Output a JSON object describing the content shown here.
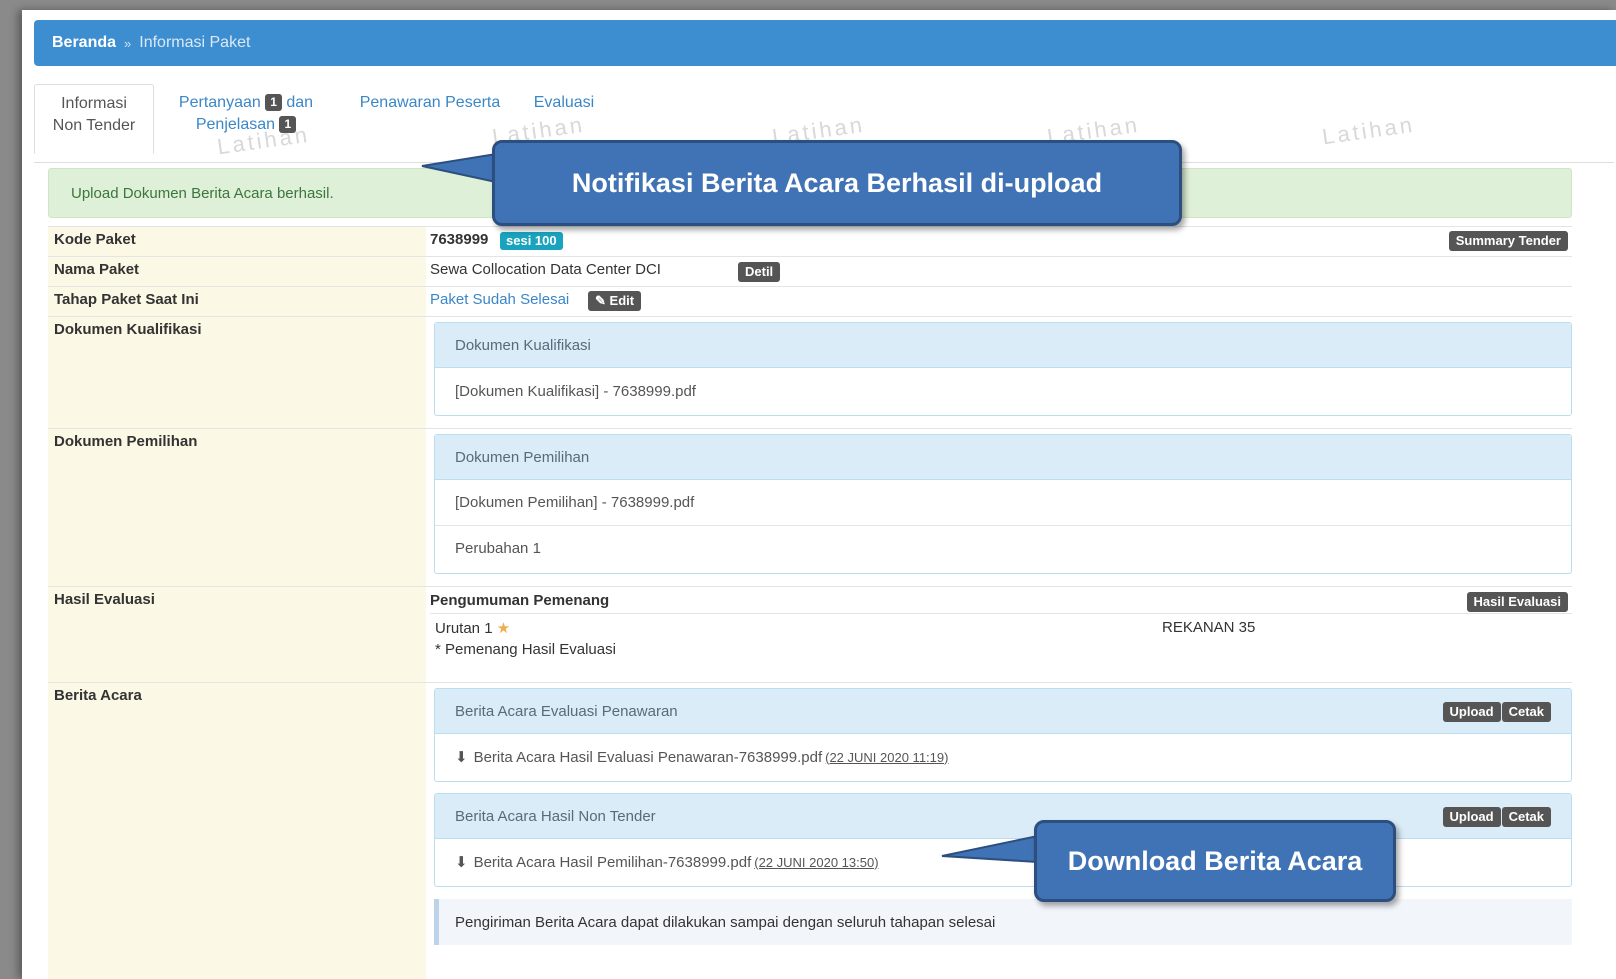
{
  "breadcrumb": {
    "home": "Beranda",
    "separator": "»",
    "current": "Informasi Paket"
  },
  "tabs": {
    "info_line1": "Informasi",
    "info_line2": "Non Tender",
    "pertanyaan": "Pertanyaan",
    "dan": "dan",
    "penjelasan": "Penjelasan",
    "pertanyaan_count": "1",
    "penjelasan_count": "1",
    "penawaran": "Penawaran Peserta",
    "evaluasi": "Evaluasi"
  },
  "watermark": "Latihan",
  "alert": {
    "text": "Upload Dokumen Berita Acara berhasil."
  },
  "callouts": {
    "notification": "Notifikasi Berita Acara Berhasil di-upload",
    "download": "Download Berita Acara"
  },
  "kode_paket": {
    "label": "Kode Paket",
    "value": "7638999",
    "sesi": "sesi 100",
    "summary_button": "Summary Tender"
  },
  "nama_paket": {
    "label": "Nama Paket",
    "value": "Sewa Collocation Data Center DCI",
    "detil_button": "Detil"
  },
  "tahap_paket": {
    "label": "Tahap Paket Saat Ini",
    "value": "Paket Sudah Selesai",
    "edit_button": "Edit"
  },
  "dokumen_kualifikasi": {
    "label": "Dokumen Kualifikasi",
    "panel_title": "Dokumen Kualifikasi",
    "file": "[Dokumen Kualifikasi] - 7638999.pdf"
  },
  "dokumen_pemilihan": {
    "label": "Dokumen Pemilihan",
    "panel_title": "Dokumen Pemilihan",
    "file": "[Dokumen Pemilihan] - 7638999.pdf",
    "perubahan": "Perubahan 1"
  },
  "hasil_evaluasi": {
    "label": "Hasil Evaluasi",
    "title": "Pengumuman Pemenang",
    "button": "Hasil Evaluasi",
    "urutan": "Urutan 1",
    "rekanan": "REKANAN 35",
    "note": "* Pemenang Hasil Evaluasi"
  },
  "berita_acara": {
    "label": "Berita Acara",
    "upload": "Upload",
    "cetak": "Cetak",
    "evaluasi_title": "Berita Acara Evaluasi Penawaran",
    "evaluasi_file": "Berita Acara Hasil Evaluasi Penawaran-7638999.pdf",
    "evaluasi_date": "(22 JUNI 2020 11:19)",
    "nontender_title": "Berita Acara Hasil Non Tender",
    "nontender_file": "Berita Acara Hasil Pemilihan-7638999.pdf",
    "nontender_date": "(22 JUNI 2020 13:50)",
    "note": "Pengiriman Berita Acara dapat dilakukan sampai dengan seluruh tahapan selesai"
  },
  "colors": {
    "accent": "#3d8ed0",
    "callout": "#3f73b5",
    "alert_bg": "#dff0d8",
    "label_bg": "#fcf8e6"
  }
}
